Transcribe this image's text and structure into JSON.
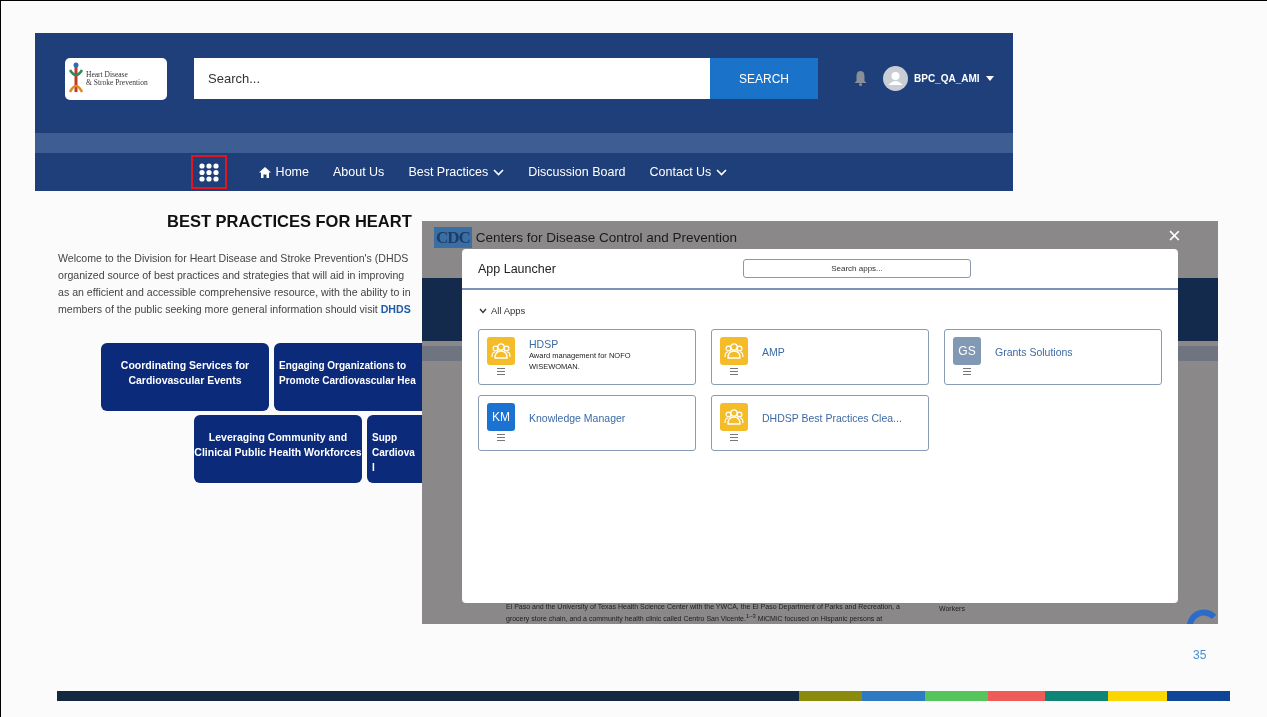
{
  "site": {
    "logo": {
      "lines": [
        "Heart Disease",
        "& Stroke Prevention"
      ]
    },
    "search": {
      "placeholder": "Search..."
    },
    "search_button": "SEARCH",
    "user": {
      "name": "BPC_QA_AMI"
    },
    "app_launcher": {
      "highlighted": true
    },
    "nav": [
      {
        "label": "Home",
        "kind": "home"
      },
      {
        "label": "About Us",
        "kind": "plain"
      },
      {
        "label": "Best Practices",
        "kind": "dropdown"
      },
      {
        "label": "Discussion Board",
        "kind": "plain"
      },
      {
        "label": "Contact Us",
        "kind": "dropdown"
      }
    ],
    "page": {
      "heading": "BEST PRACTICES FOR HEART",
      "lines": [
        "Welcome to the Division for Heart Disease and Stroke Prevention's (DHDS",
        "organized source of best practices and strategies that will aid in improving",
        "as an efficient and accessible comprehensive resource, with the ability to in",
        "members of the public seeking more general information should visit "
      ],
      "link": "DHDS",
      "tiles": [
        {
          "lines": [
            "Coordinating Services for",
            "Cardiovascular Events"
          ],
          "cut": false
        },
        {
          "lines": [
            "Engaging Organizations to",
            "Promote Cardiovascular Hea"
          ],
          "cut": true
        },
        {
          "lines": [
            "Leveraging Community and",
            "Clinical Public Health Workforces"
          ],
          "cut": false
        },
        {
          "lines": [
            "Supp",
            "Cardiova",
            "I"
          ],
          "cut": true
        }
      ]
    }
  },
  "launcher_view": {
    "site_title": "Centers for Disease Control and Prevention",
    "site_logo": "CDC",
    "background_text": [
      "El Paso and the University of Texas Health Science Center with the YWCA, the El Paso Department of Parks and Recreation, a",
      "grocery store chain, and a community health clinic called Centro San Vicente.$^{1–3}$ MiCMiC focused on Hispanic persons at"
    ],
    "background_side_text": "Workers",
    "close": "×",
    "modal": {
      "title": "App Launcher",
      "search": {
        "placeholder": "Search apps..."
      },
      "section": {
        "label": "All Apps",
        "expanded": true
      },
      "apps": [
        {
          "name": "HDSP",
          "description": "Award management for NOFO WISEWOMAN.",
          "kind": "people",
          "color": "#f5bc2a"
        },
        {
          "name": "AMP",
          "kind": "people",
          "color": "#f5bc2a"
        },
        {
          "name": "Grants Solutions",
          "kind": "initials",
          "initials": "GS",
          "color": "#8299b5"
        },
        {
          "name": "Knowledge Manager",
          "kind": "initials",
          "initials": "KM",
          "color": "#1b72d1"
        },
        {
          "name": "DHDSP Best Practices Clea...",
          "kind": "people",
          "color": "#f5bc2a"
        }
      ]
    }
  },
  "slide_number": "35"
}
